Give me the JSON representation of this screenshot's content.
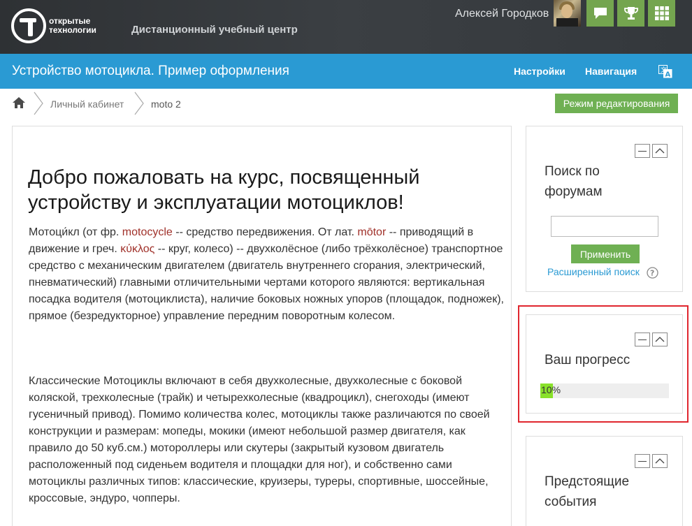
{
  "header": {
    "logo_line1": "открытые",
    "logo_line2": "технологии",
    "site_name": "Дистанционный учебный центр",
    "user_name": "Алексей Городков",
    "buttons": [
      {
        "icon": "chat-icon"
      },
      {
        "icon": "trophy-icon"
      },
      {
        "icon": "grid-icon"
      }
    ],
    "accent_color": "#74a54f"
  },
  "titlebar": {
    "course_title": "Устройство мотоцикла. Пример оформления",
    "settings_label": "Настройки",
    "navigation_label": "Навигация",
    "language_icon": "translate-icon",
    "color": "#2a9ad3"
  },
  "breadcrumb": {
    "home_icon": "home-icon",
    "items": [
      "Личный кабинет",
      "moto 2"
    ]
  },
  "edit_mode_label": "Режим редактирования",
  "main": {
    "heading": "Добро пожаловать на курс, посвященный устройству и эксплуатации мотоциклов!",
    "p1": {
      "t1": "Мотоци́кл (от фр. ",
      "link1": "motocycle",
      "t2": " -- средство передвижения. От лат. ",
      "link2": "mōtor",
      "t3": " -- приводящий в движение и греч. ",
      "link3": "κύκλος",
      "t4": " -- круг, колесо) -- двухколёсное (либо трёхколёсное) транспортное средство с механическим двигателем (двигатель внутреннего сгорания, электрический, пневматический) главными отличительными чертами которого являются: вертикальная посадка водителя (мотоциклиста), наличие боковых ножных упоров (площадок, подножек), прямое (безредукторное) управление передним поворотным колесом."
    },
    "p2": "Классические Мотоциклы включают в себя двухколесные, двухколесные с боковой коляской, трехколесные (трайк) и четырехколесные (квадроцикл), снегоходы (имеют гусеничный привод). Помимо количества колес, мотоциклы также различаются по своей конструкции и размерам: мопеды, мокики (имеют небольшой размер двигателя, как правило до 50 куб.см.) мотороллеры или скутеры (закрытый кузовом двигатель расположенный под сиденьем водителя и площадки для ног), и собственно сами мотоциклы различных типов: классические, круизеры, туреры, спортивные, шоссейные, кроссовые, эндуро, чопперы."
  },
  "blocks": {
    "search": {
      "title": "Поиск по форумам",
      "input_value": "",
      "apply_label": "Применить",
      "advanced_label": "Расширенный поиск"
    },
    "progress": {
      "title": "Ваш прогресс",
      "percent": 10,
      "label": "10%",
      "bar_color": "#89e12a",
      "highlight_color": "#e0262e"
    },
    "events": {
      "title": "Предстоящие события"
    }
  }
}
